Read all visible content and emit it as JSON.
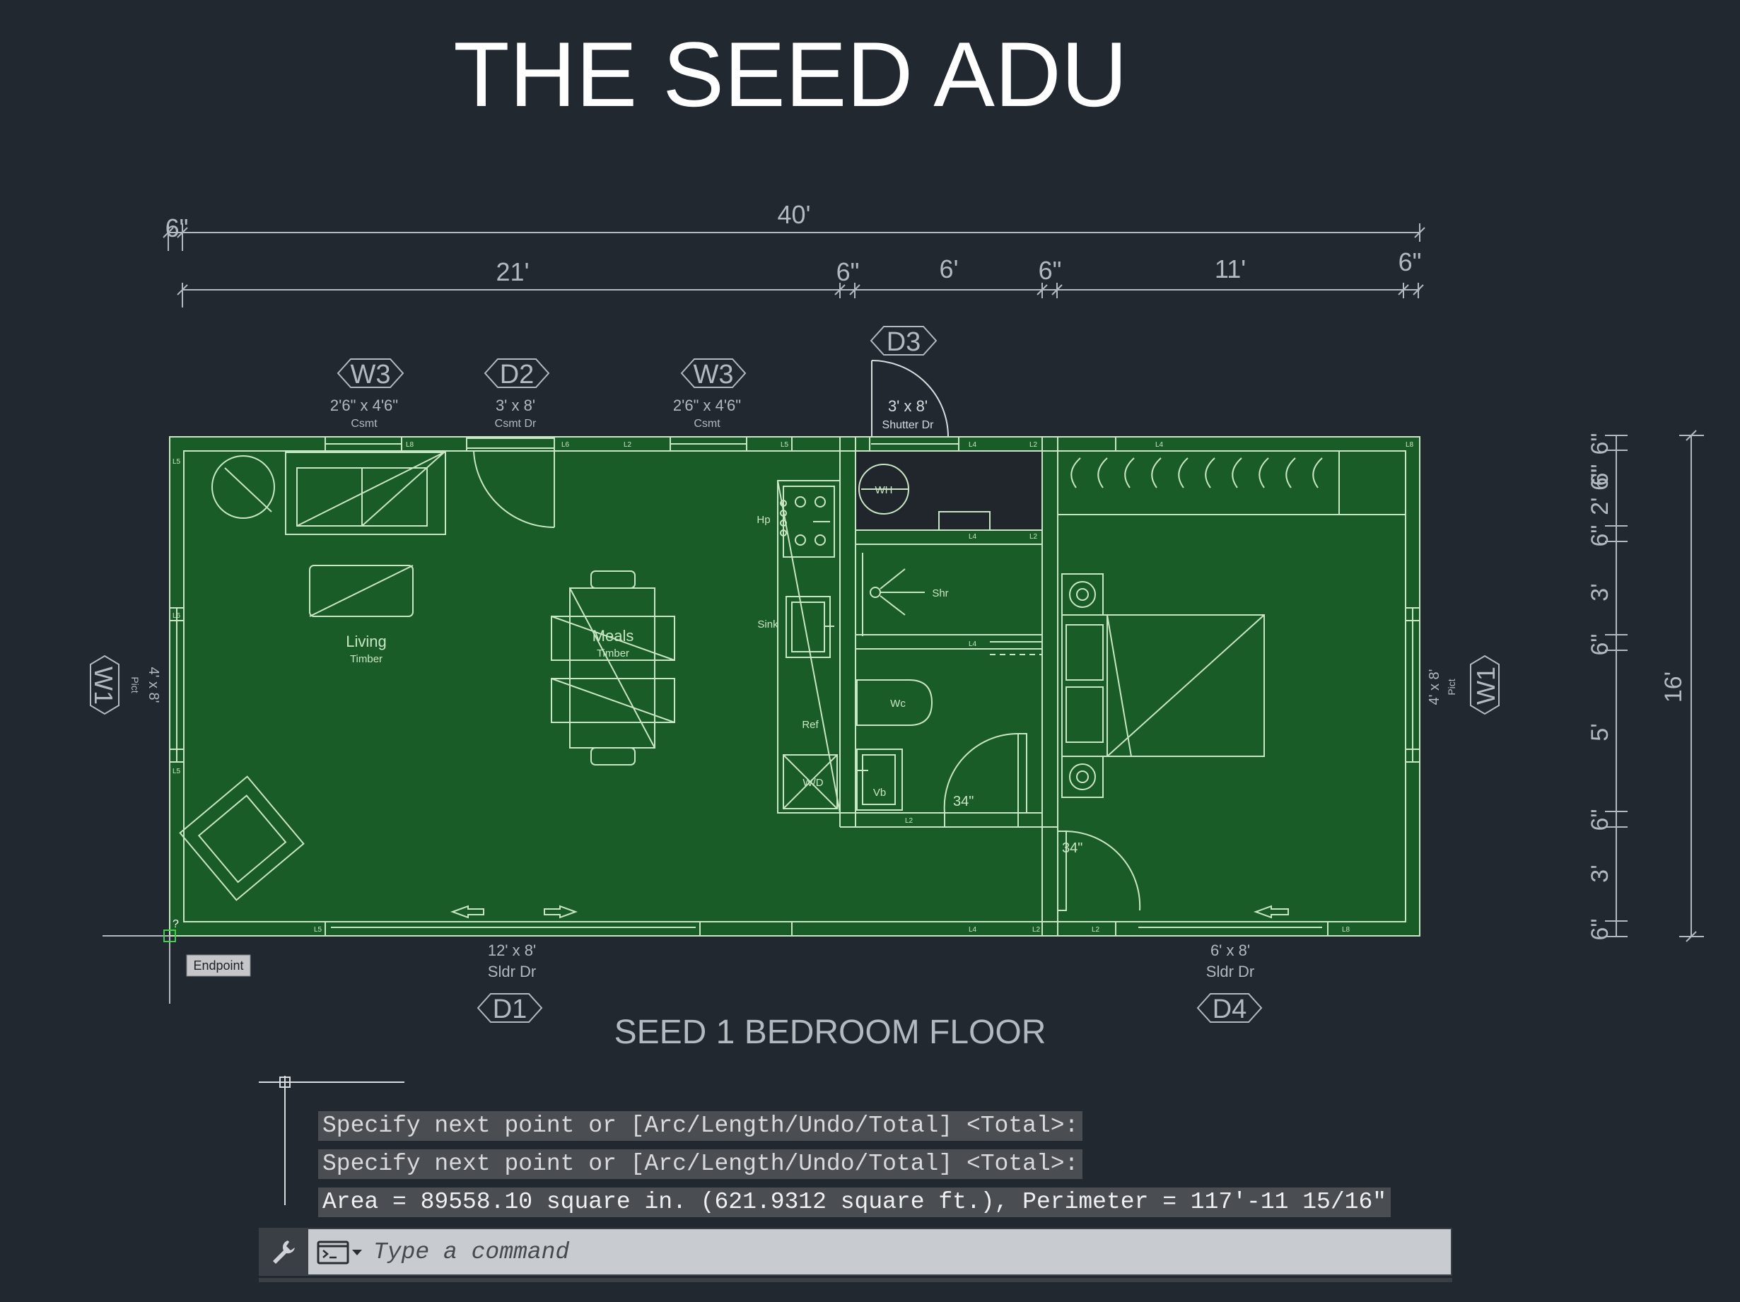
{
  "title": "THE SEED ADU",
  "drawing_title": "SEED 1 BEDROOM FLOOR",
  "dimensions": {
    "overall": "40'",
    "left_wall": "6\"",
    "living": "21'",
    "wall_a": "6\"",
    "bath": "6'",
    "wall_b": "6\"",
    "bedroom": "11'",
    "right_wall": "6\"",
    "height_total": "16'",
    "vertical": [
      "6\"",
      "6\"",
      "2' 6\"",
      "6\"",
      "3'",
      "6\"",
      "5'",
      "6\"",
      "3'",
      "6\""
    ]
  },
  "tags": {
    "w3_left": {
      "id": "W3",
      "size": "2'6\" x 4'6\"",
      "type": "Csmt"
    },
    "d2": {
      "id": "D2",
      "size": "3' x 8'",
      "type": "Csmt Dr"
    },
    "w3_right": {
      "id": "W3",
      "size": "2'6\" x 4'6\"",
      "type": "Csmt"
    },
    "d3": {
      "id": "D3",
      "size": "3' x 8'",
      "type": "Shutter Dr"
    },
    "w1_left": {
      "id": "W1",
      "size": "4' x 8'",
      "type": "Pict"
    },
    "w1_right": {
      "id": "W1",
      "size": "4' x 8'",
      "type": "Pict"
    },
    "d1": {
      "id": "D1",
      "size": "12' x 8'",
      "type": "Sldr Dr"
    },
    "d4": {
      "id": "D4",
      "size": "6' x 8'",
      "type": "Sldr Dr"
    }
  },
  "rooms": {
    "living": "Living",
    "living_sub": "Timber",
    "meals": "Meals",
    "meals_sub": "Timber"
  },
  "fixtures": {
    "hp": "Hp",
    "sink": "Sink",
    "ref": "Ref",
    "wd": "W/D",
    "wh": "WH",
    "shr": "Shr",
    "wc": "Wc",
    "vb": "Vb",
    "door_34a": "34\"",
    "door_34b": "34\""
  },
  "wall_labels": [
    "L8",
    "L6",
    "L2",
    "L5",
    "L4",
    "L2",
    "L4",
    "L8",
    "L5",
    "L6",
    "L5",
    "L4",
    "L2",
    "L4",
    "L2",
    "L5",
    "L4",
    "L2",
    "L2",
    "L8"
  ],
  "snap": {
    "tooltip": "Endpoint",
    "marker": "?"
  },
  "command_history": [
    "Specify next point or [Arc/Length/Undo/Total] <Total>:",
    "Specify next point or [Arc/Length/Undo/Total] <Total>:",
    "Area = 89558.10 square in. (621.9312 square ft.), Perimeter = 117'-11 15/16\""
  ],
  "command_line": {
    "placeholder": "Type a command"
  },
  "colors": {
    "background": "#212830",
    "plan_fill": "#1a5c27",
    "plan_line": "#c9e6c4",
    "annotation": "#b4b9bf"
  }
}
